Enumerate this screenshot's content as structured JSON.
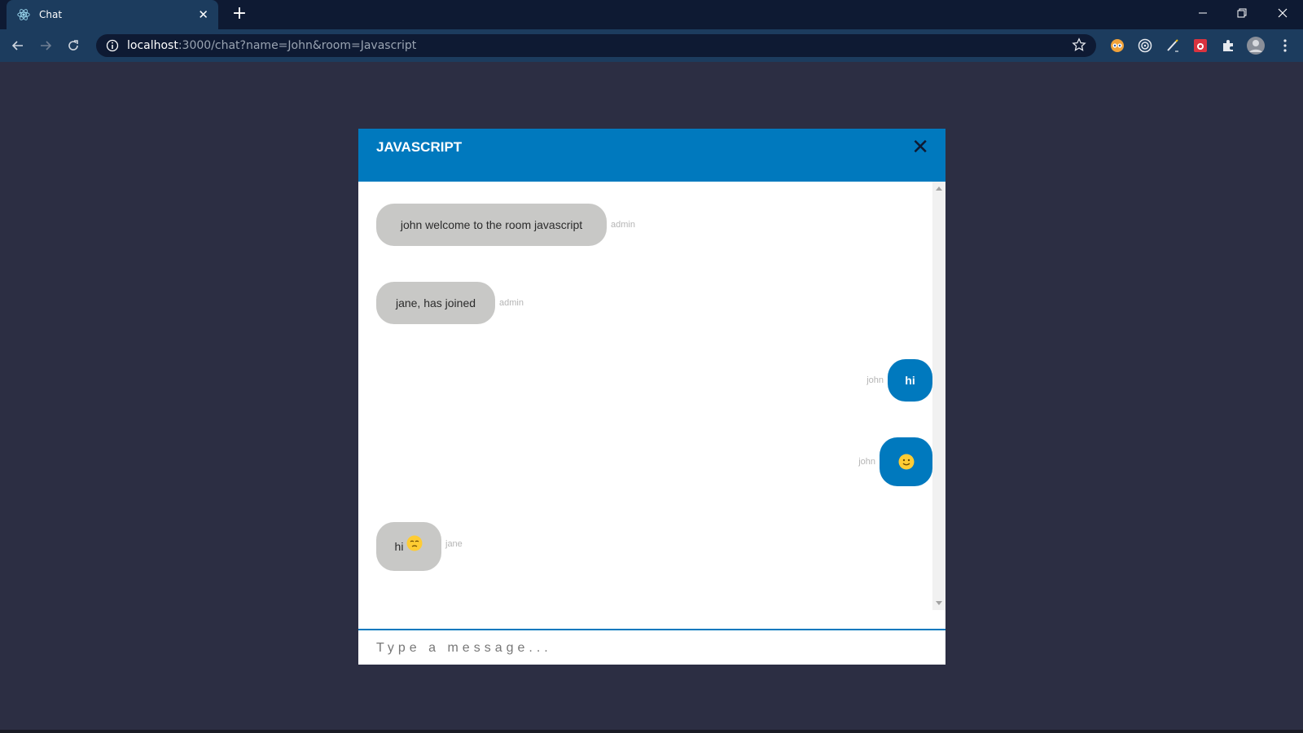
{
  "browser": {
    "tab_title": "Chat",
    "url_host": "localhost",
    "url_rest": ":3000/chat?name=John&room=Javascript",
    "icons": [
      "react-favicon-icon",
      "tab-close-icon",
      "new-tab-icon",
      "minimize-icon",
      "restore-icon",
      "window-close-icon",
      "back-icon",
      "forward-icon",
      "reload-icon",
      "site-info-icon",
      "bookmark-star-icon",
      "extension-icons",
      "profile-avatar",
      "menu-icon"
    ]
  },
  "chat": {
    "room_title": "JAVASCRIPT",
    "close_symbol": "✕",
    "accent_color": "#0079be",
    "other_bubble_color": "#c8c8c6",
    "messages": [
      {
        "text": "john welcome to the room javascript",
        "sender": "admin"
      },
      {
        "text": "jane, has joined",
        "sender": "admin"
      },
      {
        "text": "hi",
        "sender": "john"
      },
      {
        "text": "",
        "emoji": "slightly-smiling-face",
        "sender": "john"
      },
      {
        "text": "hi",
        "emoji": "unamused-face",
        "sender": "jane"
      }
    ],
    "input_placeholder": "Type a message..."
  }
}
